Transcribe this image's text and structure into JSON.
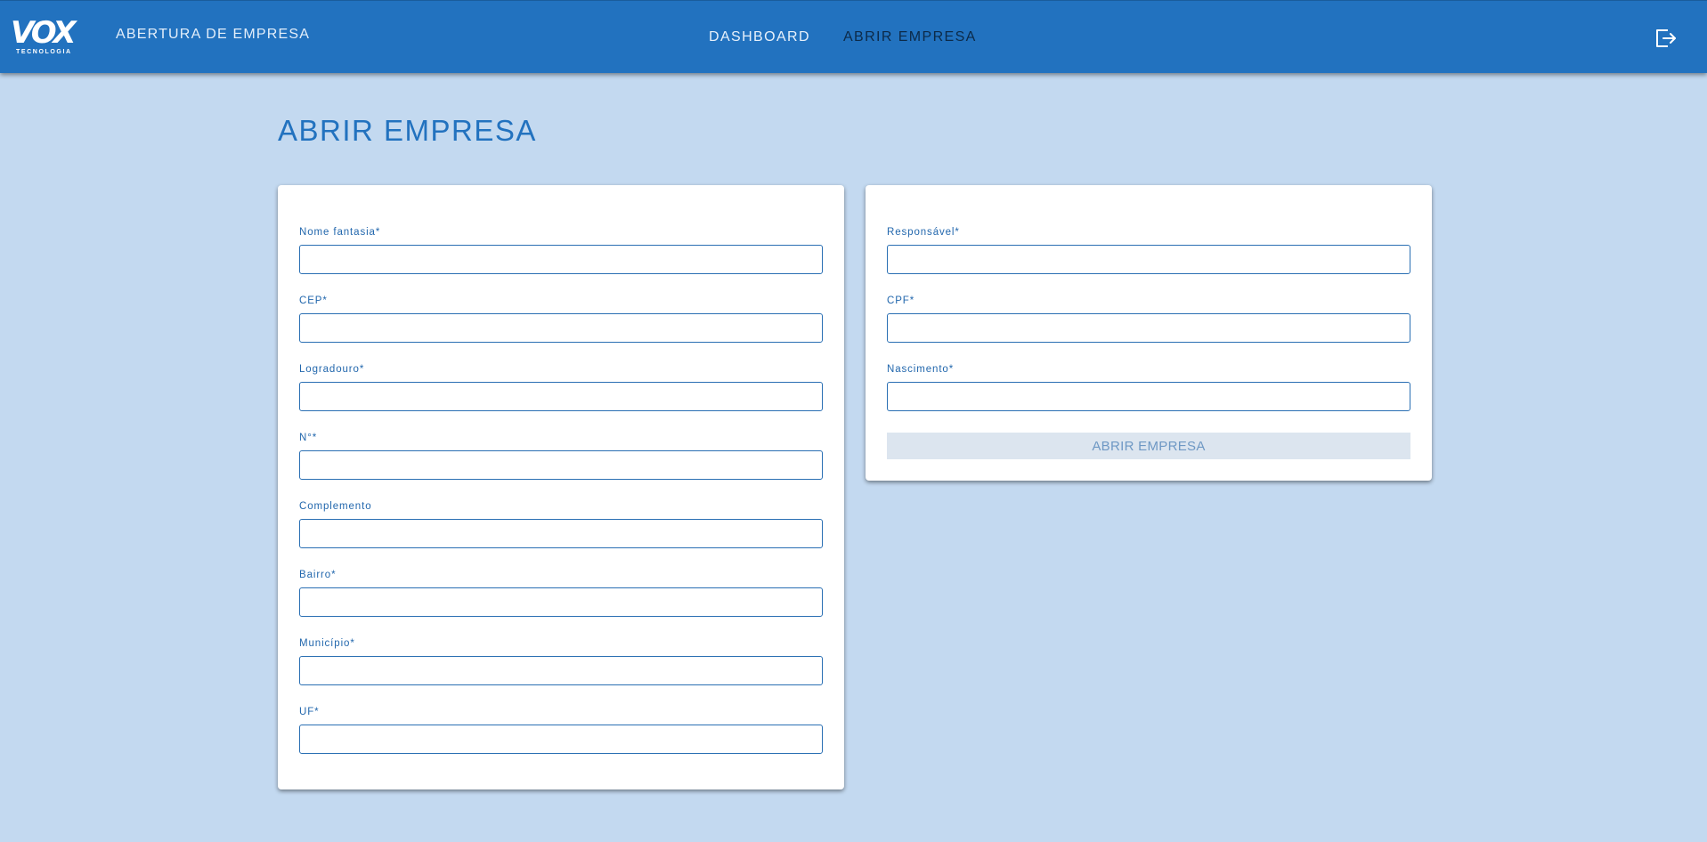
{
  "app": {
    "logo_text": "VOX",
    "logo_subtext": "TECNOLOGIA",
    "title": "ABERTURA DE EMPRESA"
  },
  "nav": {
    "items": [
      {
        "label": "DASHBOARD",
        "active": false
      },
      {
        "label": "ABRIR EMPRESA",
        "active": true
      }
    ],
    "logout_icon": "logout-icon"
  },
  "page": {
    "title": "ABRIR EMPRESA"
  },
  "form_empresa": {
    "fields": [
      {
        "label": "Nome fantasia*",
        "value": ""
      },
      {
        "label": "CEP*",
        "value": ""
      },
      {
        "label": "Logradouro*",
        "value": ""
      },
      {
        "label": "N°*",
        "value": ""
      },
      {
        "label": "Complemento",
        "value": ""
      },
      {
        "label": "Bairro*",
        "value": ""
      },
      {
        "label": "Município*",
        "value": ""
      },
      {
        "label": "UF*",
        "value": ""
      }
    ]
  },
  "form_responsavel": {
    "fields": [
      {
        "label": "Responsável*",
        "value": ""
      },
      {
        "label": "CPF*",
        "value": ""
      },
      {
        "label": "Nascimento*",
        "value": ""
      }
    ],
    "submit_label": "ABRIR EMPRESA",
    "submit_disabled": true
  },
  "colors": {
    "header": "#2272bf",
    "background": "#c3d9f0",
    "accent": "#2272bf",
    "button_disabled_bg": "#dce5ef",
    "button_disabled_text": "#6e98c4"
  }
}
